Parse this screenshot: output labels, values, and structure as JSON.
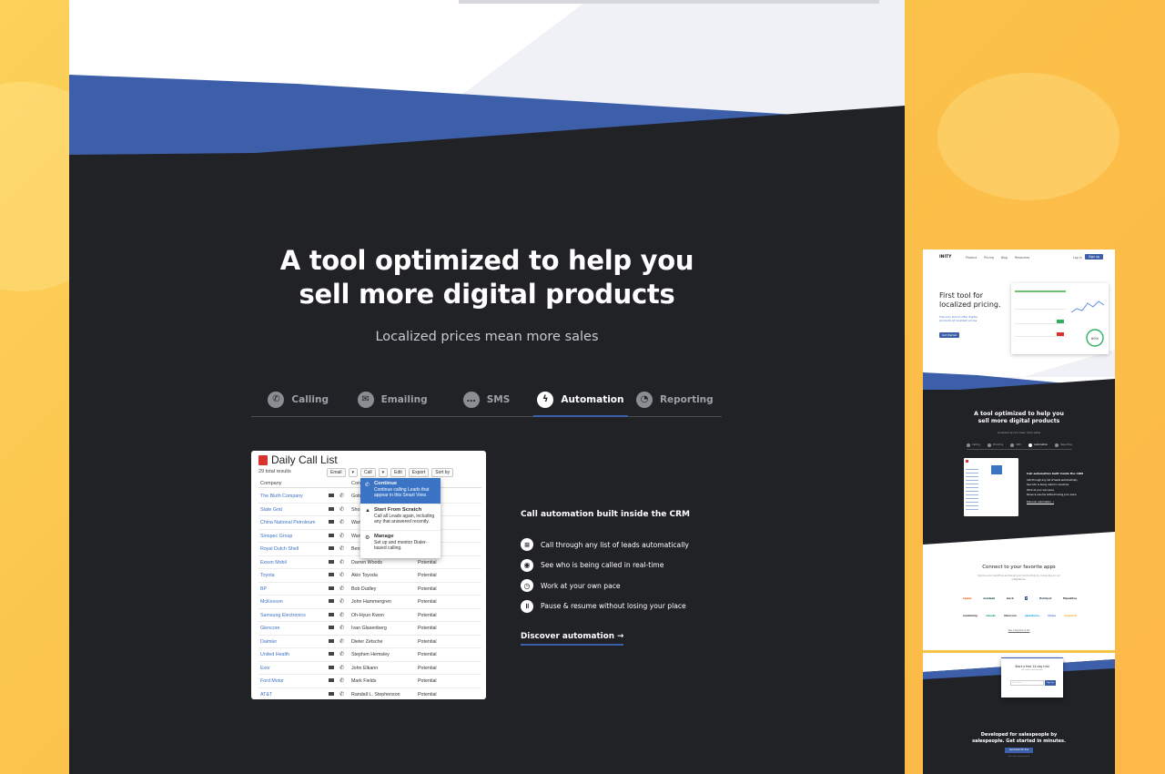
{
  "main": {
    "headline_line1": "A tool optimized to help you",
    "headline_line2": "sell more digital products",
    "subheadline": "Localized prices mean more sales",
    "tabs": [
      {
        "label": "Calling",
        "icon": "phone-icon"
      },
      {
        "label": "Emailing",
        "icon": "envelope-icon"
      },
      {
        "label": "SMS",
        "icon": "chat-bubble-icon"
      },
      {
        "label": "Automation",
        "icon": "lightning-icon",
        "active": true
      },
      {
        "label": "Reporting",
        "icon": "chart-icon"
      }
    ],
    "call_list": {
      "title": "Daily Call List",
      "total": "29 total results",
      "toolbar": {
        "email": "Email",
        "call": "Call",
        "edit": "Edit",
        "export": "Export",
        "sort": "Sort by"
      },
      "columns": {
        "company": "Company",
        "contact": "Con"
      },
      "dropdown": [
        {
          "title": "Continue",
          "desc": "Continue calling Leads that appear in this Smart View."
        },
        {
          "title": "Start From Scratch",
          "desc": "Call all Leads again, including any that answered recently."
        },
        {
          "title": "Manage",
          "desc": "Set up and monitor Dialer-based calling."
        }
      ],
      "rows": [
        {
          "company": "The Bluth Company",
          "contact": "Gob",
          "status": ""
        },
        {
          "company": "State Grid",
          "contact": "Sho",
          "status": ""
        },
        {
          "company": "China National Petroleum",
          "contact": "Wan",
          "status": ""
        },
        {
          "company": "Sinopec Group",
          "contact": "Wan",
          "status": ""
        },
        {
          "company": "Royal Dutch Shell",
          "contact": "Ben",
          "status": ""
        },
        {
          "company": "Exxon Mobil",
          "contact": "Darren Woods",
          "status": "Potential"
        },
        {
          "company": "Toyota",
          "contact": "Akio Toyoda",
          "status": "Potential"
        },
        {
          "company": "BP",
          "contact": "Bob Dudley",
          "status": "Potential"
        },
        {
          "company": "McKesson",
          "contact": "John Hammergren",
          "status": "Potential"
        },
        {
          "company": "Samsung Electronics",
          "contact": "Oh-Hyun Kwon",
          "status": "Potential"
        },
        {
          "company": "Glencore",
          "contact": "Ivan Glasenberg",
          "status": "Potential"
        },
        {
          "company": "Daimler",
          "contact": "Dieter Zetsche",
          "status": "Potential"
        },
        {
          "company": "United Health",
          "contact": "Stephen Hemsley",
          "status": "Potential"
        },
        {
          "company": "Exor",
          "contact": "John Elkann",
          "status": "Potential"
        },
        {
          "company": "Ford Motor",
          "contact": "Mark Fields",
          "status": "Potential"
        },
        {
          "company": "AT&T",
          "contact": "Randall L. Stephenson",
          "status": "Potential"
        }
      ]
    },
    "features": {
      "title": "Call automation built inside the CRM",
      "items": [
        {
          "text": "Call through any list of leads automatically",
          "icon": "list-icon"
        },
        {
          "text": "See who is being called in real-time",
          "icon": "eye-icon"
        },
        {
          "text": "Work at your own pace",
          "icon": "clock-icon"
        },
        {
          "text": "Pause & resume without losing your place",
          "icon": "pause-icon"
        }
      ],
      "link": "Discover automation →"
    }
  },
  "thumbnail": {
    "logo": "INITY",
    "nav": [
      "Product",
      "Pricing",
      "Blog",
      "Resources"
    ],
    "login": "Log in",
    "signup": "Sign up",
    "hero_title": "First tool for localized pricing.",
    "hero_sub": "The only tool to offer digital products at localized prices",
    "hero_button": "Get Started",
    "dash_gauge": "60%",
    "section_title_1": "A tool optimized to help you",
    "section_title_2": "sell more digital products",
    "section_sub": "Localized prices mean more sales",
    "tabs": [
      "Calling",
      "Emailing",
      "SMS",
      "Automation",
      "Reporting"
    ],
    "features_title": "Call automation built inside the CRM",
    "features": [
      "Call through any list of leads automatically",
      "See who is being called in real-time",
      "Work at your own pace",
      "Pause & resume without losing your place"
    ],
    "features_link": "Discover automation →",
    "apps_title": "Connect to your favorite apps",
    "apps_sub": "Improve your workflow and boost your productivity by connecting to our integrations.",
    "apps_row1": [
      "zapier",
      "zendesk",
      "slack",
      "f",
      "HubSpot",
      "Pipedrive"
    ],
    "apps_row2": [
      "mailchimp",
      "sheets",
      "intercom",
      "salesforce",
      "stripe",
      "segment"
    ],
    "apps_link": "See integrations list",
    "form_title": "Start a free 14-day trial",
    "form_sub": "No credit card required",
    "form_placeholder": "Your email",
    "form_button": "Sign up",
    "footer_title_1": "Developed for salespeople by",
    "footer_title_2": "salespeople. Get started in minutes.",
    "footer_button": "Get started for free",
    "footer_note": "No credit card required"
  },
  "colors": {
    "accent": "#3d5ea9",
    "dark": "#212226",
    "link": "#3b73c5",
    "bg": "#fbc24a"
  }
}
